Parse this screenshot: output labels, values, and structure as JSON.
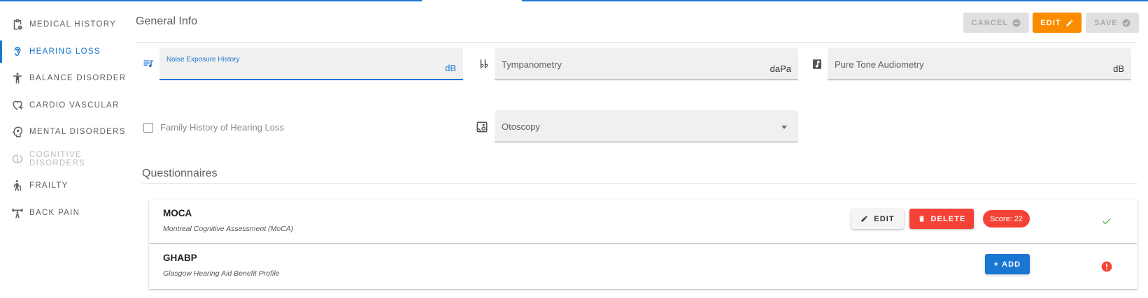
{
  "sidebar": {
    "items": [
      {
        "label": "MEDICAL HISTORY",
        "icon": "clipboard-clock-icon",
        "state": "normal"
      },
      {
        "label": "HEARING LOSS",
        "icon": "ear-icon",
        "state": "active"
      },
      {
        "label": "BALANCE DISORDER",
        "icon": "person-standing-icon",
        "state": "normal"
      },
      {
        "label": "CARDIO VASCULAR",
        "icon": "heart-pulse-icon",
        "state": "normal"
      },
      {
        "label": "MENTAL DISORDERS",
        "icon": "head-gear-icon",
        "state": "normal"
      },
      {
        "label": "COGNITIVE DISORDERS",
        "icon": "brain-icon",
        "state": "disabled"
      },
      {
        "label": "FRAILTY",
        "icon": "person-cane-icon",
        "state": "normal"
      },
      {
        "label": "BACK PAIN",
        "icon": "weightlifter-icon",
        "state": "normal"
      }
    ]
  },
  "header": {
    "title": "General Info",
    "cancel_label": "CANCEL",
    "edit_label": "EDIT",
    "save_label": "SAVE"
  },
  "fields": {
    "noise": {
      "label": "Noise Exposure History",
      "suffix": "dB",
      "icon": "music-list-icon"
    },
    "tympanometry": {
      "label": "Tympanometry",
      "suffix": "daPa",
      "icon": "double-flat-icon"
    },
    "pure_tone": {
      "label": "Pure Tone Audiometry",
      "suffix": "dB",
      "icon": "music-note-box-icon"
    },
    "family_history": {
      "label": "Family History of Hearing Loss",
      "checked": false
    },
    "otoscopy": {
      "label": "Otoscopy",
      "icon": "cast-audio-icon"
    }
  },
  "questionnaires": {
    "title": "Questionnaires",
    "items": [
      {
        "name": "MOCA",
        "description": "Montreal Cognitive Assessment (MoCA)",
        "edit_label": "EDIT",
        "delete_label": "DELETE",
        "score_label": "Score: 22",
        "status": "check-icon"
      },
      {
        "name": "GHABP",
        "description": "Glasgow Hearing Aid Benefit Profile",
        "add_label": "+ ADD",
        "status": "alert-circle-icon"
      }
    ]
  },
  "colors": {
    "primary": "#1976d2",
    "warning": "#fb8c00",
    "danger": "#f44336",
    "success": "#4caf50"
  }
}
